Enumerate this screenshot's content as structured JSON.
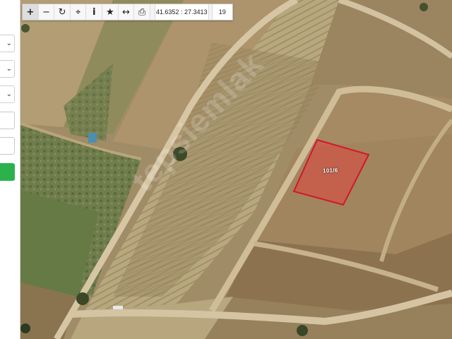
{
  "toolbar": {
    "buttons": [
      {
        "name": "zoom-in",
        "glyph": "+"
      },
      {
        "name": "zoom-out",
        "glyph": "−"
      },
      {
        "name": "refresh",
        "glyph": "↻"
      },
      {
        "name": "locate",
        "glyph": "⌖"
      },
      {
        "name": "info",
        "glyph": "i"
      },
      {
        "name": "favorite",
        "glyph": "★"
      },
      {
        "name": "measure",
        "glyph": "↔"
      },
      {
        "name": "print",
        "glyph": "⎙"
      }
    ],
    "coordinates": "41.6352 : 27.3413",
    "zoom_level": "19"
  },
  "map": {
    "parcel_label": "101/6",
    "watermark": "tepsiemlak",
    "parcel_color": "#e0443c"
  },
  "side_panel": {
    "rows": [
      {
        "type": "select",
        "icon": "chevron-down-icon",
        "glyph": "⌄"
      },
      {
        "type": "select",
        "icon": "chevron-down-icon",
        "glyph": "⌄"
      },
      {
        "type": "select",
        "icon": "chevron-down-icon",
        "glyph": "⌄"
      },
      {
        "type": "input",
        "icon": "",
        "glyph": ""
      },
      {
        "type": "input",
        "icon": "",
        "glyph": ""
      },
      {
        "type": "button",
        "icon": "",
        "glyph": ""
      }
    ],
    "accent_color": "#2bb24c"
  }
}
